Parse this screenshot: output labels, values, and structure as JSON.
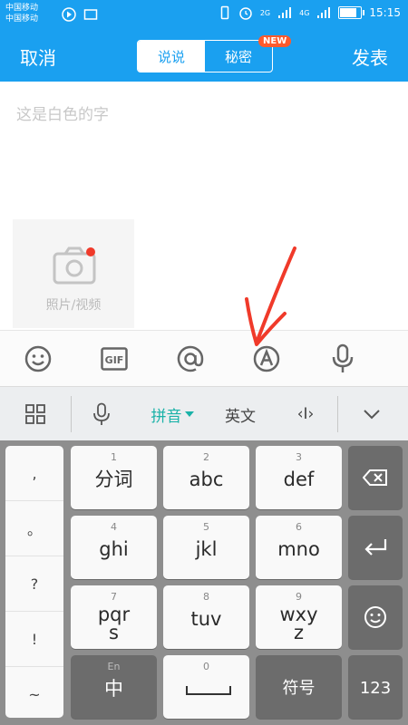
{
  "status_bar": {
    "carrier_1": "中国移动",
    "carrier_2": "中国移动",
    "net_1": "2G",
    "net_2": "4G",
    "time": "15:15"
  },
  "header": {
    "cancel_label": "取消",
    "publish_label": "发表",
    "tab_shuoshuo": "说说",
    "tab_mimi": "秘密",
    "new_badge": "NEW"
  },
  "editor": {
    "text": "这是白色的字",
    "photo_label": "照片/视频"
  },
  "toolbar": {
    "icons": [
      "smiley-icon",
      "gif-icon",
      "at-icon",
      "font-icon",
      "mic-icon"
    ]
  },
  "ime": {
    "pinyin": "拼音",
    "english": "英文",
    "cursor": "‹I›"
  },
  "keyboard": {
    "punct": [
      ",",
      "。",
      "?",
      "!",
      "~"
    ],
    "keys": [
      {
        "num": "1",
        "label": "分词"
      },
      {
        "num": "2",
        "label": "abc"
      },
      {
        "num": "3",
        "label": "def"
      },
      {
        "num": "4",
        "label": "ghi"
      },
      {
        "num": "5",
        "label": "jkl"
      },
      {
        "num": "6",
        "label": "mno"
      },
      {
        "num": "7",
        "label": "pqrs"
      },
      {
        "num": "8",
        "label": "tuv"
      },
      {
        "num": "9",
        "label": "wxyz"
      }
    ],
    "lang_hint": "En",
    "lang_key": "中",
    "space_num": "0",
    "symbols": "符号",
    "num_key": "123"
  },
  "colors": {
    "brand": "#1aa0f0",
    "annotation": "#f03a2a",
    "pinyin": "#1ab2a8"
  }
}
